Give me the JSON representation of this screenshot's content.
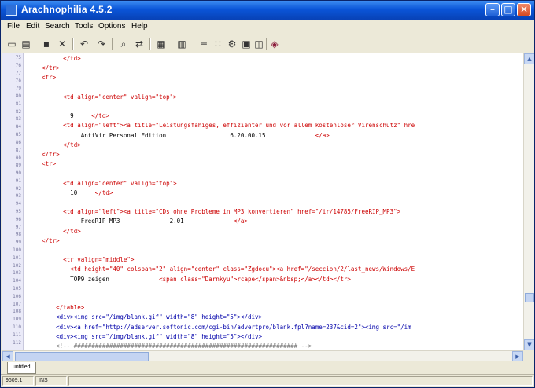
{
  "window": {
    "title": "Arachnophilia 4.5.2",
    "minimize": "–",
    "maximize": "□",
    "close": "✕"
  },
  "menu": [
    "File",
    "Edit",
    "Search",
    "Tools",
    "Options",
    "Help"
  ],
  "toolbar": {
    "icons": [
      "new-file-icon",
      "open-folder-icon",
      "save-icon",
      "close-doc-icon",
      "undo-icon",
      "redo-icon",
      "find-icon",
      "replace-icon",
      "table-icon",
      "grid-icon",
      "list-icon",
      "tag-icon",
      "script-icon",
      "preview-icon",
      "browser-icon",
      "rgb-icon"
    ],
    "glyphs": [
      "▭",
      "▤",
      "▪",
      "✕",
      "↶",
      "↷",
      "⌕",
      "⇄",
      "▦",
      "▥",
      "≡",
      "∷",
      "⚙",
      "▣",
      "◫",
      "◈"
    ]
  },
  "editor": {
    "line_numbers": [
      "75",
      "76",
      "77",
      "78",
      "79",
      "80",
      "81",
      "82",
      "83",
      "84",
      "85",
      "86",
      "87",
      "88",
      "89",
      "90",
      "91",
      "92",
      "93",
      "94",
      "95",
      "96",
      "97",
      "98",
      "99",
      "100",
      "101",
      "102",
      "103",
      "104",
      "105",
      "106",
      "107",
      "108",
      "109",
      "110",
      "111",
      "112"
    ],
    "lines": [
      [
        {
          "t": "          </td>",
          "c": "tag"
        }
      ],
      [
        {
          "t": "    </tr>",
          "c": "tag"
        }
      ],
      [
        {
          "t": "    <tr>",
          "c": "tag"
        }
      ],
      [
        {
          "t": "",
          "c": "txt"
        }
      ],
      [
        {
          "t": "          <td align=\"center\" valign=\"top\">",
          "c": "tag"
        }
      ],
      [
        {
          "t": "",
          "c": "txt"
        }
      ],
      [
        {
          "t": "            9     ",
          "c": "txt"
        },
        {
          "t": "</td>",
          "c": "tag"
        }
      ],
      [
        {
          "t": "          <td align=\"left\"><a title=\"Leistungsfähiges, effizienter und vor allem kostenloser Virenschutz\" hre",
          "c": "tag"
        }
      ],
      [
        {
          "t": "               AntiVir Personal Edition                  6.20.00.15              ",
          "c": "txt"
        },
        {
          "t": "</a>",
          "c": "tag"
        }
      ],
      [
        {
          "t": "          </td>",
          "c": "tag"
        }
      ],
      [
        {
          "t": "    </tr>",
          "c": "tag"
        }
      ],
      [
        {
          "t": "    <tr>",
          "c": "tag"
        }
      ],
      [
        {
          "t": "",
          "c": "txt"
        }
      ],
      [
        {
          "t": "          <td align=\"center\" valign=\"top\">",
          "c": "tag"
        }
      ],
      [
        {
          "t": "            10     ",
          "c": "txt"
        },
        {
          "t": "</td>",
          "c": "tag"
        }
      ],
      [
        {
          "t": "",
          "c": "txt"
        }
      ],
      [
        {
          "t": "          <td align=\"left\"><a title=\"CDs ohne Probleme in MP3 konvertieren\" href=\"/ir/14785/FreeRIP_MP3\">",
          "c": "tag"
        }
      ],
      [
        {
          "t": "               FreeRIP MP3              2.01              ",
          "c": "txt"
        },
        {
          "t": "</a>",
          "c": "tag"
        }
      ],
      [
        {
          "t": "          </td>",
          "c": "tag"
        }
      ],
      [
        {
          "t": "    </tr>",
          "c": "tag"
        }
      ],
      [
        {
          "t": "",
          "c": "txt"
        }
      ],
      [
        {
          "t": "          <tr valign=\"middle\">",
          "c": "tag"
        }
      ],
      [
        {
          "t": "            <td height=\"40\" colspan=\"2\" align=\"center\" class=\"Zgdocu\"><a href=\"/seccion/2/last_news/Windows/E",
          "c": "tag"
        }
      ],
      [
        {
          "t": "            TOP9 zeigen              ",
          "c": "txt"
        },
        {
          "t": "<span class=\"Darnkyu\">rcape</span>&nbsp;</a></td></tr>",
          "c": "tag"
        }
      ],
      [
        {
          "t": "",
          "c": "txt"
        }
      ],
      [
        {
          "t": "",
          "c": "txt"
        }
      ],
      [
        {
          "t": "        </table>",
          "c": "tag"
        }
      ],
      [
        {
          "t": "        <div><img src=\"/img/blank.gif\" width=\"8\" height=\"5\"></div>",
          "c": "blue"
        }
      ],
      [
        {
          "t": "        <div><a href=\"http://adserver.softonic.com/cgi-bin/advertpro/blank.fpl?name=237&cid=2\"><img src=\"/im",
          "c": "blue"
        }
      ],
      [
        {
          "t": "        <div><img src=\"/img/blank.gif\" width=\"8\" height=\"5\"></div>",
          "c": "blue"
        }
      ],
      [
        {
          "t": "        <!-- ############################################################### -->",
          "c": "comment"
        }
      ]
    ]
  },
  "tabs": [
    "untitled"
  ],
  "status": [
    "9609:1",
    "INS",
    ""
  ]
}
